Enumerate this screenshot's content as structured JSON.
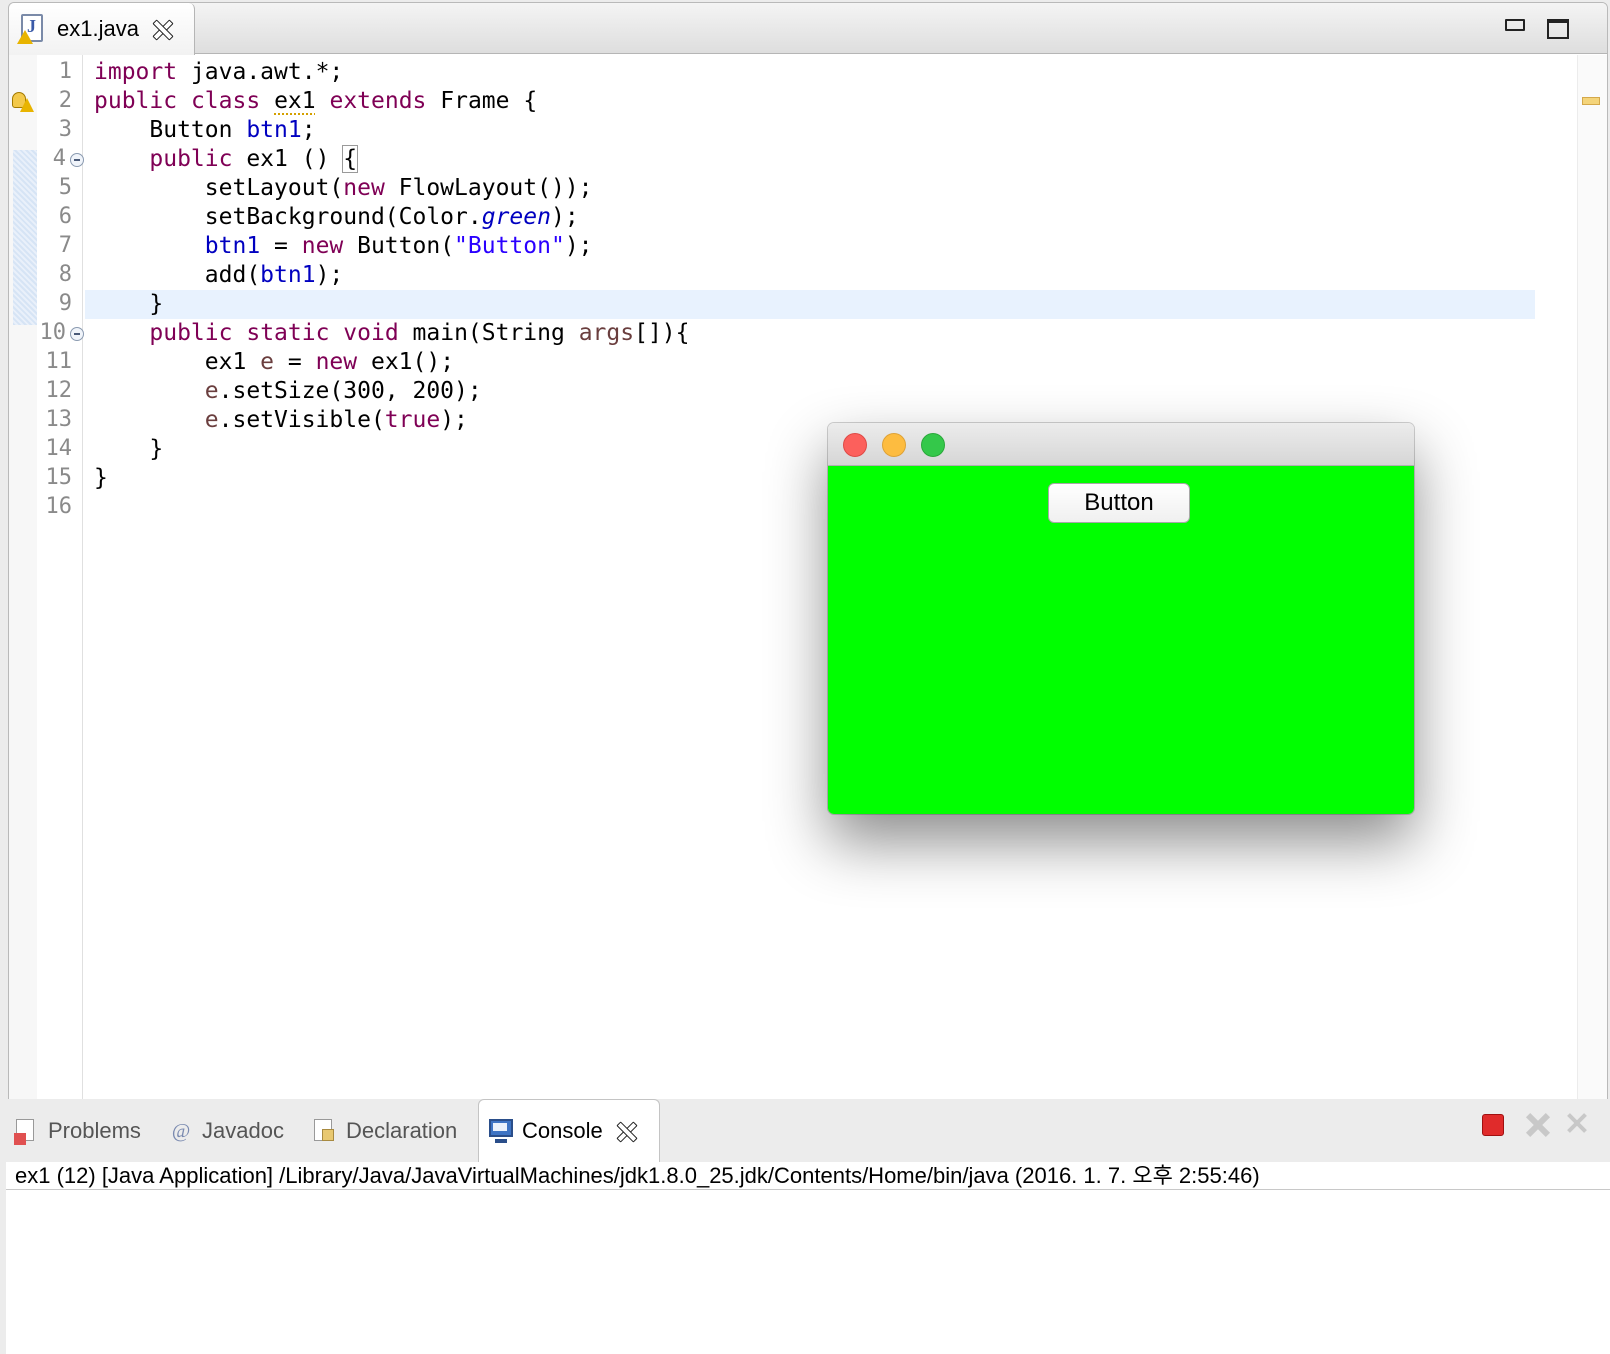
{
  "editor": {
    "tab_label": "ex1.java",
    "line_numbers": [
      "1",
      "2",
      "3",
      "4",
      "5",
      "6",
      "7",
      "8",
      "9",
      "10",
      "11",
      "12",
      "13",
      "14",
      "15",
      "16"
    ]
  },
  "code": {
    "l1": {
      "kw": "import",
      "rest": " java.awt.*;"
    },
    "l2": {
      "kw1": "public",
      "kw2": "class",
      "name": "ex1",
      "kw3": "extends",
      "rest": " Frame {"
    },
    "l3": {
      "type": "    Button ",
      "field": "btn1",
      "rest": ";"
    },
    "l4": {
      "kw": "    public",
      "rest": " ex1 () ",
      "brace": "{"
    },
    "l5": {
      "pre": "        setLayout(",
      "kw": "new",
      "rest": " FlowLayout());"
    },
    "l6": {
      "pre": "        setBackground(Color.",
      "static": "green",
      "rest": ");"
    },
    "l7": {
      "field": "        btn1",
      "mid": " = ",
      "kw": "new",
      "pre": " Button(",
      "str": "\"Button\"",
      "rest": ");"
    },
    "l8": {
      "pre": "        add(",
      "field": "btn1",
      "rest": ");"
    },
    "l9": {
      "text": "    }"
    },
    "l10": {
      "kw1": "    public",
      "kw2": "static",
      "kw3": "void",
      "pre": " main(String ",
      "param": "args",
      "rest": "[]){"
    },
    "l11": {
      "pre": "        ex1 ",
      "param": "e",
      "mid": " = ",
      "kw": "new",
      "rest": " ex1();"
    },
    "l12": {
      "param": "        e",
      "rest": ".setSize(300, 200);"
    },
    "l13": {
      "param": "        e",
      "pre": ".setVisible(",
      "kw": "true",
      "rest": ");"
    },
    "l14": {
      "text": "    }"
    },
    "l15": {
      "text": "}"
    }
  },
  "awt_window": {
    "button_label": "Button",
    "background_color": "#00ff00"
  },
  "bottom_panel": {
    "tabs": [
      {
        "label": "Problems"
      },
      {
        "label": "Javadoc"
      },
      {
        "label": "Declaration"
      },
      {
        "label": "Console"
      }
    ],
    "console_header": "ex1 (12) [Java Application] /Library/Java/JavaVirtualMachines/jdk1.8.0_25.jdk/Contents/Home/bin/java (2016. 1. 7. 오후 2:55:46)"
  }
}
